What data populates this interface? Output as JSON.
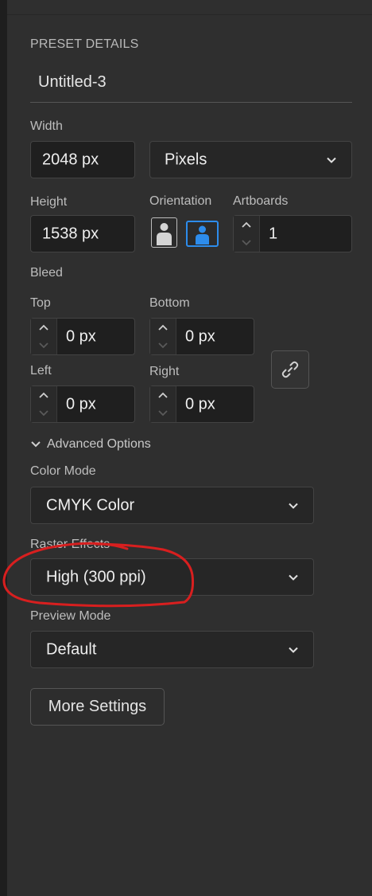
{
  "panel": {
    "section_title": "PRESET DETAILS",
    "preset_name": "Untitled-3"
  },
  "size": {
    "width_label": "Width",
    "width_value": "2048 px",
    "units_value": "Pixels",
    "height_label": "Height",
    "height_value": "1538 px",
    "orientation_label": "Orientation",
    "artboards_label": "Artboards",
    "artboards_value": "1"
  },
  "bleed": {
    "label": "Bleed",
    "top_label": "Top",
    "top_value": "0 px",
    "bottom_label": "Bottom",
    "bottom_value": "0 px",
    "left_label": "Left",
    "left_value": "0 px",
    "right_label": "Right",
    "right_value": "0 px"
  },
  "advanced": {
    "toggle_label": "Advanced Options",
    "color_mode_label": "Color Mode",
    "color_mode_value": "CMYK Color",
    "raster_label": "Raster Effects",
    "raster_value": "High (300 ppi)",
    "preview_label": "Preview Mode",
    "preview_value": "Default"
  },
  "more_settings_label": "More Settings",
  "colors": {
    "background": "#2f2f2f",
    "field": "#1f1f1f",
    "accent": "#2d8ceb",
    "annotation": "#d81f1f"
  }
}
